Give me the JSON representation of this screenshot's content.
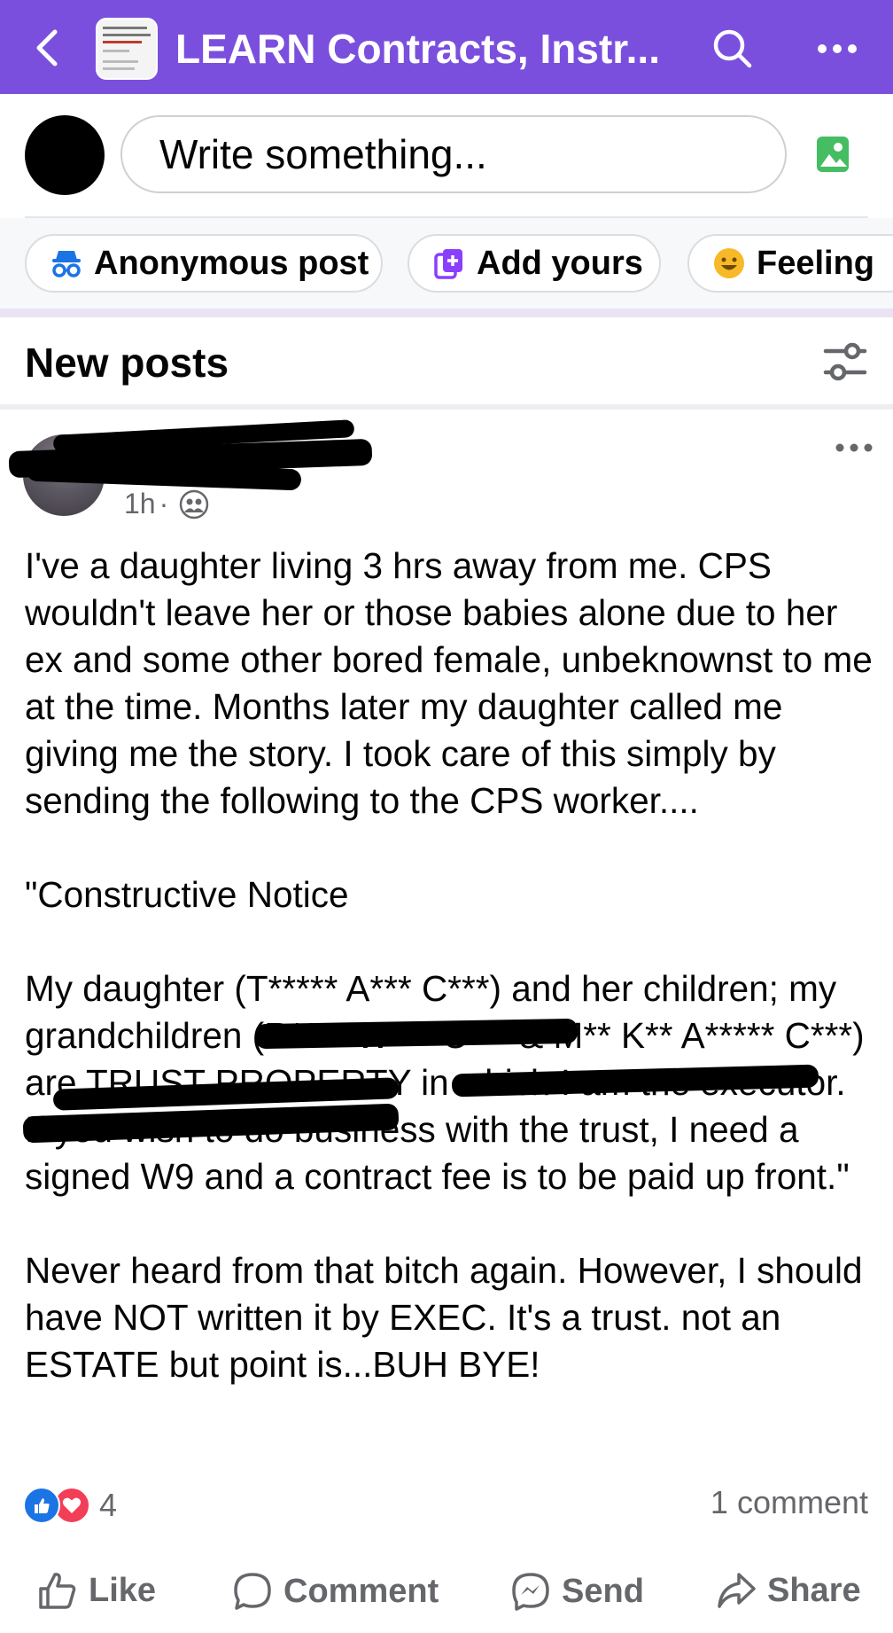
{
  "topbar": {
    "title": "LEARN Contracts, Instr...",
    "colors": {
      "background": "#7b4fdd"
    },
    "icons": [
      "back-arrow-icon",
      "search-icon",
      "more-icon"
    ]
  },
  "composer": {
    "placeholder": "Write something..."
  },
  "chips": [
    {
      "label": "Anonymous post",
      "icon": "anonymous-icon"
    },
    {
      "label": "Add yours",
      "icon": "add-yours-icon"
    },
    {
      "label": "Feeling",
      "icon": "feeling-emoji-icon"
    }
  ],
  "feed": {
    "section_title": "New posts"
  },
  "post": {
    "time": "1h",
    "body": "I've a daughter living 3 hrs away from me. CPS wouldn't leave her or those babies alone due to her ex and some other bored female, unbeknownst to me at the time. Months later my daughter called me giving me the story. I took care of this simply by sending the following to the CPS worker....\n\n\"Constructive Notice\n\nMy daughter (T***** A*** C***) and her children; my grandchildren (R**** W*** C*** & M** K** A***** C***) are TRUST PROPERTY in which I am the executor. If you wish to do business with the trust, I need a signed W9 and a contract fee is to be paid up front.\"\n\nNever heard from that bitch again. However, I should have NOT written it by EXEC. It's a trust. not an ESTATE but point is...BUH BYE!",
    "reaction_count": "4",
    "comment_count": "1 comment"
  },
  "actions": {
    "like": "Like",
    "comment": "Comment",
    "send": "Send",
    "share": "Share"
  }
}
